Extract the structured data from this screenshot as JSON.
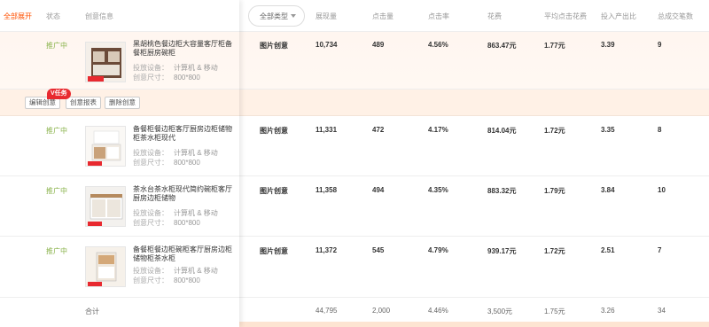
{
  "header": {
    "expand_all": "全部展开",
    "status": "状态",
    "creative_info": "创意信息",
    "type_filter": "全部类型",
    "impressions": "展现量",
    "clicks": "点击量",
    "ctr": "点击率",
    "spend": "花费",
    "avg_cpc": "平均点击花费",
    "roi": "投入产出比",
    "transactions": "总成交笔数"
  },
  "meta_labels": {
    "device": "投放设备：",
    "size": "创意尺寸："
  },
  "actions": {
    "edit": "编辑创意",
    "report": "创意报表",
    "delete": "删除创意",
    "v_badge": "V任务"
  },
  "rows": [
    {
      "status": "推广中",
      "title": "黑胡桃色餐边柜大容量客厅柜备餐柜厨房碗柜",
      "device": "计算机 & 移动",
      "size": "800*800",
      "type": "图片创意",
      "impressions": "10,734",
      "clicks": "489",
      "ctr": "4.56%",
      "spend": "863.47元",
      "avg_cpc": "1.77元",
      "roi": "3.39",
      "transactions": "9"
    },
    {
      "status": "推广中",
      "title": "备餐柜餐边柜客厅厨房边柜储物柜茶水柜现代",
      "device": "计算机 & 移动",
      "size": "800*800",
      "type": "图片创意",
      "impressions": "11,331",
      "clicks": "472",
      "ctr": "4.17%",
      "spend": "814.04元",
      "avg_cpc": "1.72元",
      "roi": "3.35",
      "transactions": "8"
    },
    {
      "status": "推广中",
      "title": "茶水台茶水柜现代简约碗柜客厅厨房边柜储物",
      "device": "计算机 & 移动",
      "size": "800*800",
      "type": "图片创意",
      "impressions": "11,358",
      "clicks": "494",
      "ctr": "4.35%",
      "spend": "883.32元",
      "avg_cpc": "1.79元",
      "roi": "3.84",
      "transactions": "10"
    },
    {
      "status": "推广中",
      "title": "备餐柜餐边柜碗柜客厅厨房边柜储物柜茶水柜",
      "device": "计算机 & 移动",
      "size": "800*800",
      "type": "图片创意",
      "impressions": "11,372",
      "clicks": "545",
      "ctr": "4.79%",
      "spend": "939.17元",
      "avg_cpc": "1.72元",
      "roi": "2.51",
      "transactions": "7"
    }
  ],
  "total": {
    "label": "合计",
    "impressions": "44,795",
    "clicks": "2,000",
    "ctr": "4.46%",
    "spend": "3,500元",
    "avg_cpc": "1.75元",
    "roi": "3.26",
    "transactions": "34"
  },
  "colors": {
    "accent": "#ff5000",
    "status_green": "#8ab34b",
    "highlight_bg": "#fff1e6",
    "badge_red": "#e8292f"
  }
}
